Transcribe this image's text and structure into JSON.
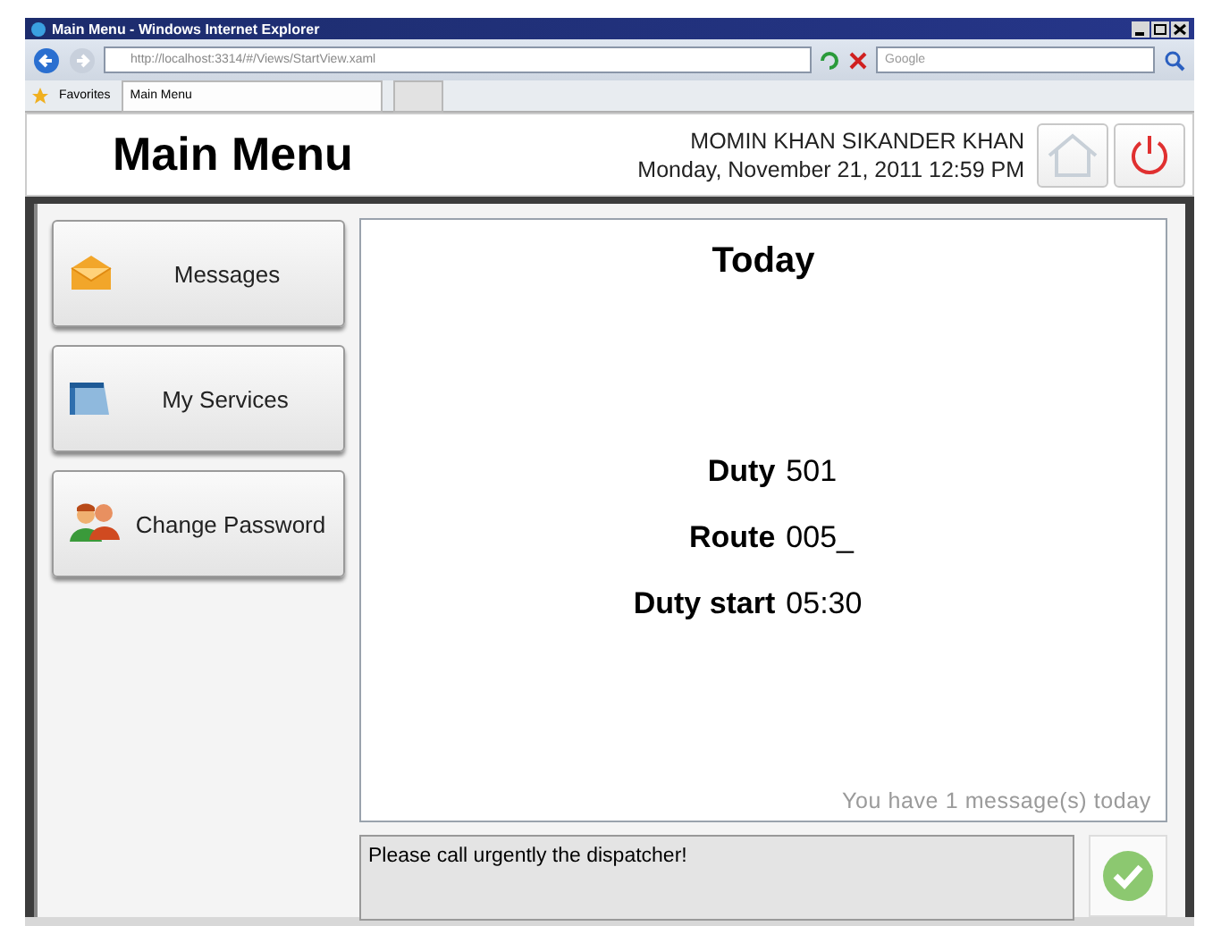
{
  "window": {
    "title": "Main Menu - Windows Internet Explorer"
  },
  "browser": {
    "address": "http://localhost:3314/#/Views/StartView.xaml",
    "search_placeholder": "Google",
    "favorites": "Favorites",
    "tab": "Main Menu"
  },
  "header": {
    "title": "Main Menu",
    "user": "MOMIN KHAN SIKANDER KHAN",
    "datetime": "Monday, November 21, 2011 12:59 PM"
  },
  "menu": [
    {
      "label": "Messages",
      "kind": "envelope"
    },
    {
      "label": "My Services",
      "kind": "folder"
    },
    {
      "label": "Change Password",
      "kind": "people"
    }
  ],
  "today": {
    "title": "Today",
    "fields": [
      {
        "label": "Duty",
        "value": "501"
      },
      {
        "label": "Route",
        "value": "005_"
      },
      {
        "label": "Duty start",
        "value": "05:30"
      }
    ],
    "footer": "You have 1 message(s) today"
  },
  "message": {
    "text": "Please call urgently the dispatcher!"
  }
}
